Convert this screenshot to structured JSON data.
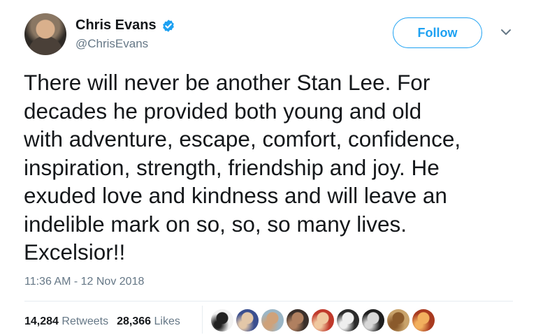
{
  "tweet": {
    "author_name": "Chris Evans",
    "handle": "@ChrisEvans",
    "follow_label": "Follow",
    "text": "There will never be another Stan Lee. For\ndecades he provided both young and old\nwith adventure, escape, comfort, confidence,\ninspiration, strength, friendship and joy. He\nexuded love and kindness and will leave an\nindelible mark on so, so, so many lives.\nExcelsior!!",
    "timestamp": "11:36 AM - 12 Nov 2018"
  },
  "stats": {
    "retweets_count": "14,284",
    "retweets_label": "Retweets",
    "likes_count": "28,366",
    "likes_label": "Likes"
  },
  "colors": {
    "accent": "#1da1f2",
    "secondary_text": "#657786",
    "primary_text": "#14171a"
  },
  "icons": {
    "verified": "verified-badge-icon",
    "caret": "chevron-down-icon"
  },
  "likers": [
    {
      "color_a": "#f2f2f2",
      "color_b": "#222222"
    },
    {
      "color_a": "#3b4f8f",
      "color_b": "#e3c7a8"
    },
    {
      "color_a": "#9bb6c6",
      "color_b": "#cfa27a"
    },
    {
      "color_a": "#3a2f2a",
      "color_b": "#b08060"
    },
    {
      "color_a": "#c0392b",
      "color_b": "#f0c8a0"
    },
    {
      "color_a": "#2b2b2b",
      "color_b": "#eeeeee"
    },
    {
      "color_a": "#1e1e1e",
      "color_b": "#d8d8d8"
    },
    {
      "color_a": "#c9a36b",
      "color_b": "#8a5a2b"
    },
    {
      "color_a": "#a83a1f",
      "color_b": "#f2b05e"
    }
  ]
}
